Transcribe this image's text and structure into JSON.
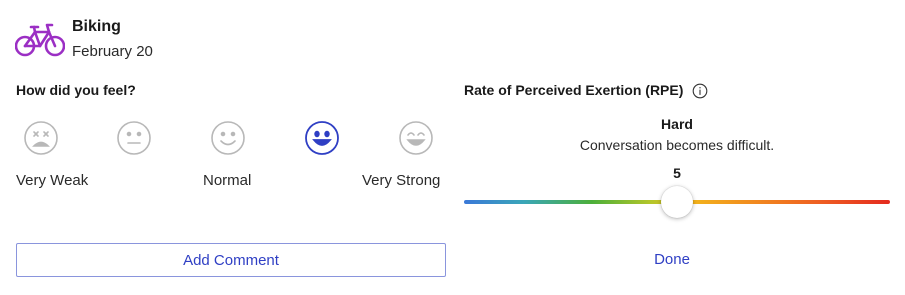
{
  "activity": {
    "title": "Biking",
    "date": "February 20",
    "icon": "bicycle-icon",
    "icon_color": "#9b2fc4"
  },
  "feel": {
    "heading": "How did you feel?",
    "options": [
      {
        "icon": "face-very-weak-icon",
        "selected": false
      },
      {
        "icon": "face-weak-icon",
        "selected": false
      },
      {
        "icon": "face-normal-icon",
        "selected": false
      },
      {
        "icon": "face-strong-icon",
        "selected": true
      },
      {
        "icon": "face-very-strong-icon",
        "selected": false
      }
    ],
    "labels": {
      "very_weak": "Very Weak",
      "normal": "Normal",
      "very_strong": "Very Strong"
    },
    "selected_color": "#2f3fc4",
    "unselected_color": "#b8b8b8"
  },
  "comment": {
    "button_label": "Add Comment"
  },
  "rpe": {
    "heading": "Rate of Perceived Exertion (RPE)",
    "info_icon": "info-icon",
    "level": "Hard",
    "description": "Conversation becomes difficult.",
    "value": "5",
    "slider_fraction": 0.5
  },
  "done": {
    "label": "Done"
  },
  "colors": {
    "accent": "#2f3fc4",
    "border": "#8a95dd"
  }
}
